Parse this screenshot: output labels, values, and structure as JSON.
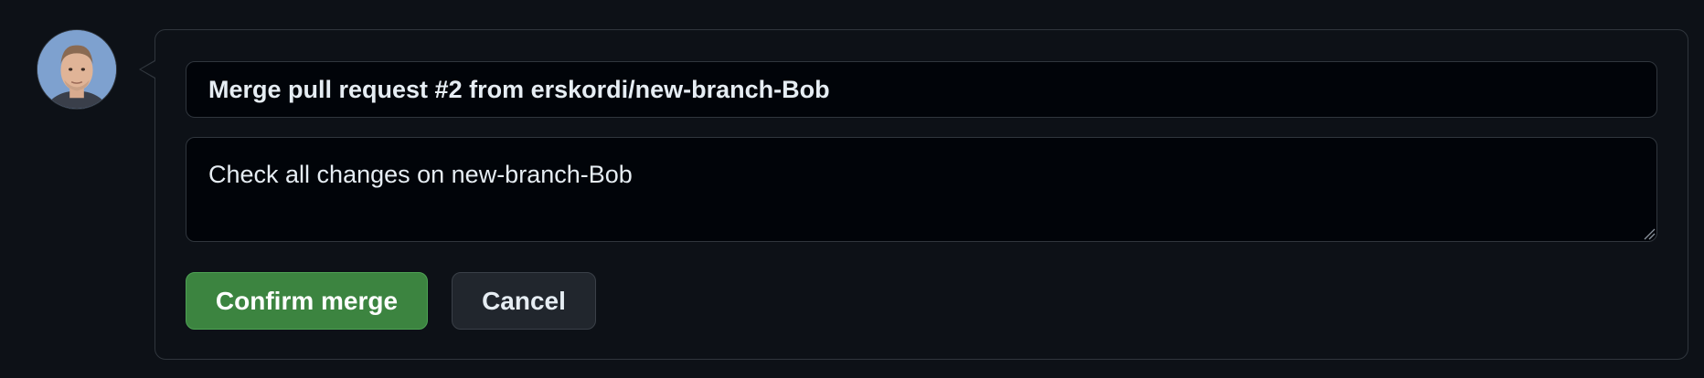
{
  "merge_form": {
    "avatar_icon": "user-avatar",
    "commit_title": "Merge pull request #2 from erskordi/new-branch-Bob",
    "commit_message": "Check all changes on new-branch-Bob",
    "confirm_label": "Confirm merge",
    "cancel_label": "Cancel"
  },
  "colors": {
    "page_background": "#0d1117",
    "border": "#30363d",
    "input_background": "#010409",
    "confirm_button": "#3c8440",
    "cancel_button": "#21262d",
    "text": "#e6edf3"
  }
}
